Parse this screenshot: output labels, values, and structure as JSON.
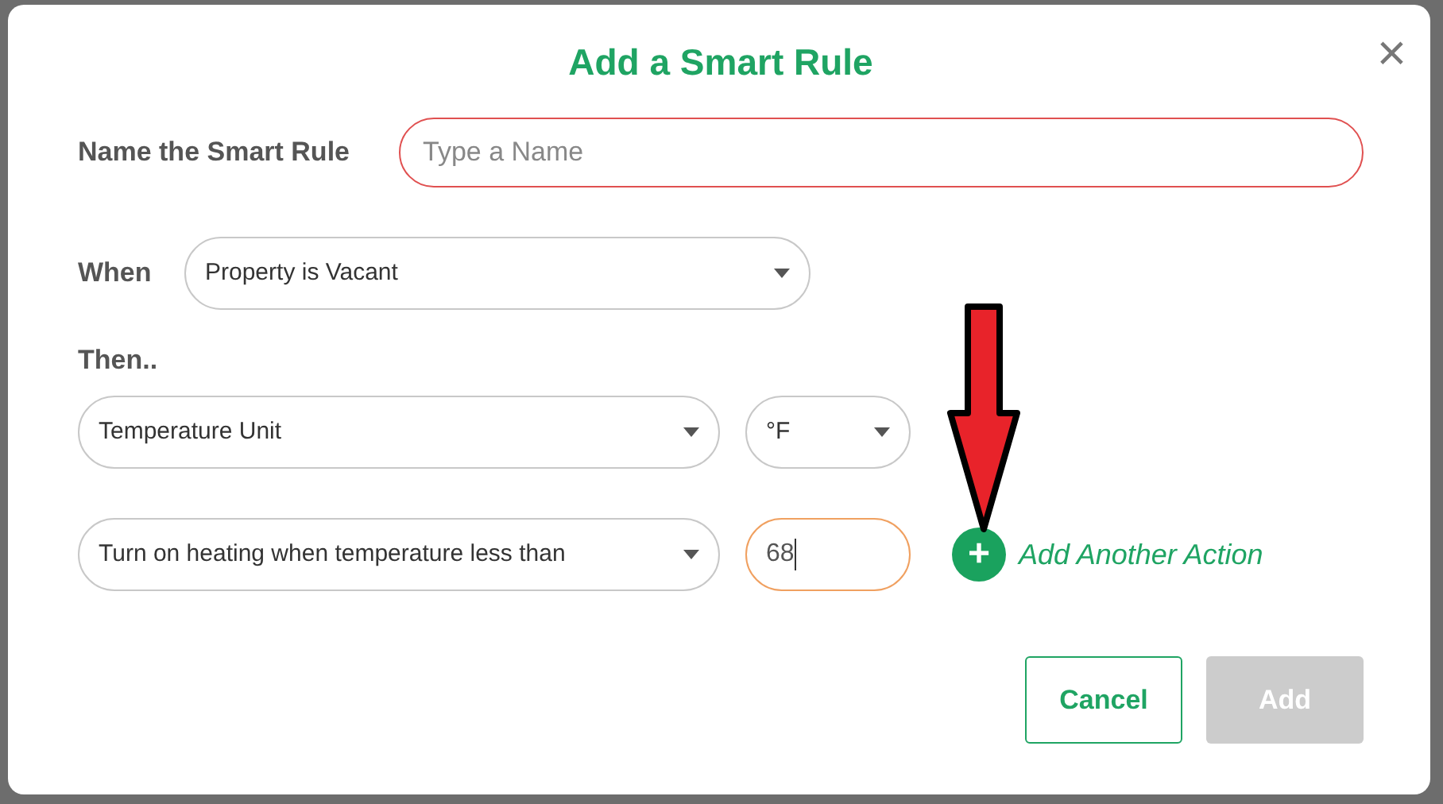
{
  "dialog": {
    "title": "Add a Smart Rule",
    "close": "×"
  },
  "name_field": {
    "label": "Name the Smart Rule",
    "placeholder": "Type a Name",
    "invalid": true
  },
  "when": {
    "label": "When",
    "value": "Property is Vacant"
  },
  "then_label": "Then..",
  "actions": [
    {
      "kind": "unit",
      "action": "Temperature Unit",
      "option": "°F"
    },
    {
      "kind": "threshold",
      "action": "Turn on heating when temperature less than",
      "value": "68",
      "focused": true
    }
  ],
  "add_action": {
    "icon": "+",
    "label": "Add Another Action"
  },
  "buttons": {
    "cancel": {
      "label": "Cancel"
    },
    "add": {
      "label": "Add",
      "disabled": true
    }
  }
}
